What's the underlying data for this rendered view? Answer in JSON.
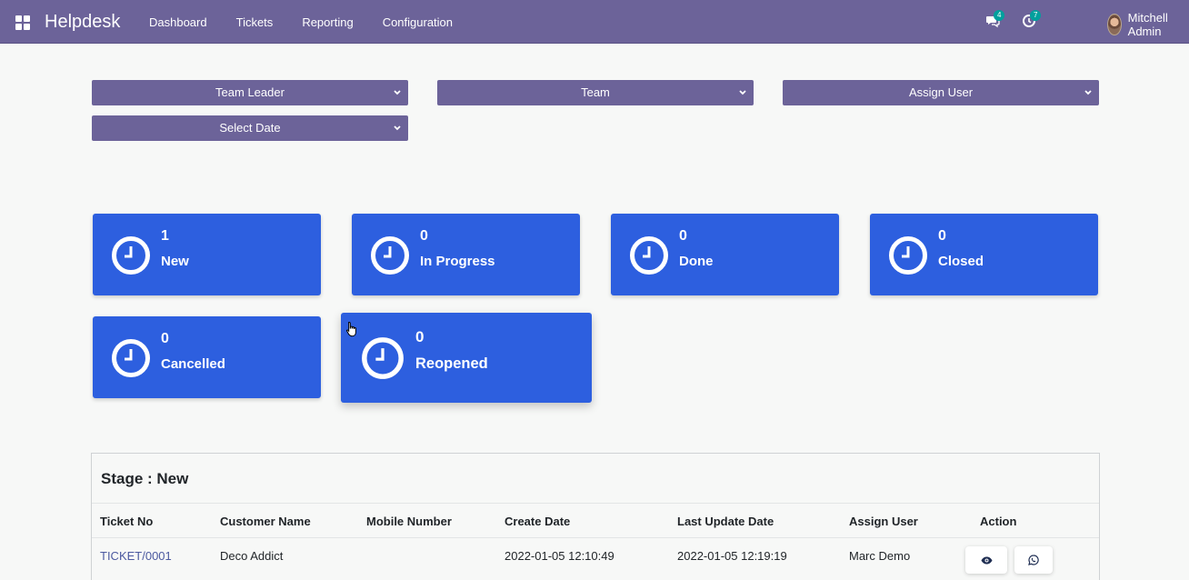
{
  "navbar": {
    "brand": "Helpdesk",
    "menu": [
      "Dashboard",
      "Tickets",
      "Reporting",
      "Configuration"
    ],
    "messages_count": "4",
    "activities_count": "7",
    "user_name": "Mitchell Admin"
  },
  "filters": {
    "team_leader": "Team Leader",
    "team": "Team",
    "assign_user": "Assign User",
    "select_date": "Select Date"
  },
  "cards": [
    {
      "count": "1",
      "label": "New"
    },
    {
      "count": "0",
      "label": "In Progress"
    },
    {
      "count": "0",
      "label": "Done"
    },
    {
      "count": "0",
      "label": "Closed"
    },
    {
      "count": "0",
      "label": "Cancelled"
    },
    {
      "count": "0",
      "label": "Reopened"
    }
  ],
  "table": {
    "title": "Stage : New",
    "headers": [
      "Ticket No",
      "Customer Name",
      "Mobile Number",
      "Create Date",
      "Last Update Date",
      "Assign User",
      "Action"
    ],
    "rows": [
      {
        "ticket_no": "TICKET/0001",
        "customer": "Deco Addict",
        "mobile": "",
        "create_date": "2022-01-05 12:10:49",
        "last_update": "2022-01-05 12:19:19",
        "assign_user": "Marc Demo"
      }
    ]
  },
  "colors": {
    "navbar": "#6c6399",
    "card": "#2d5fdf",
    "badge": "#00a09d"
  }
}
